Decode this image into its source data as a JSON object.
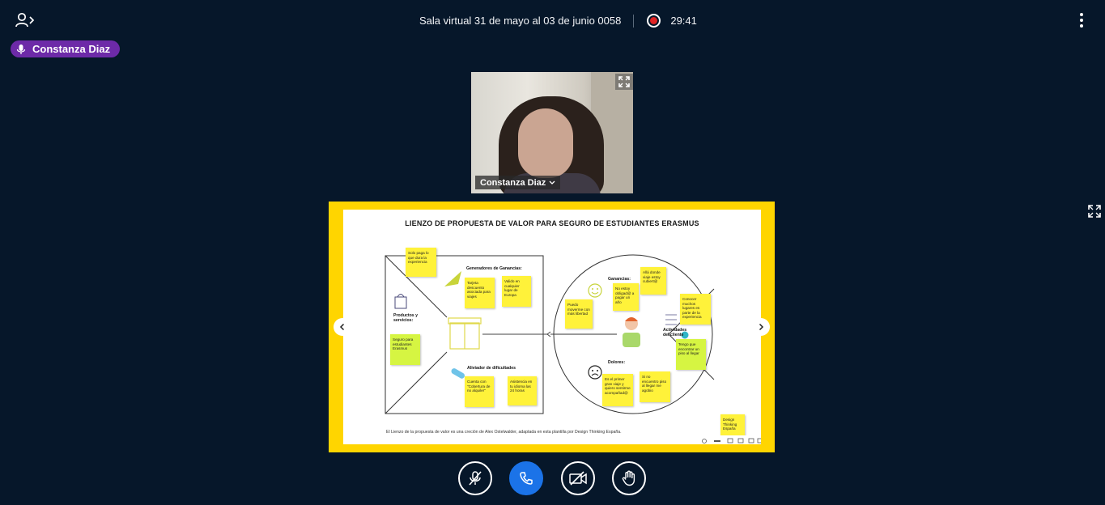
{
  "session": {
    "title": "Sala virtual 31 de mayo al 03 de junio 0058",
    "recording_time": "29:41",
    "recording_color": "#e02424"
  },
  "talker": {
    "name": "Constanza Diaz",
    "color": "#6d2aa8"
  },
  "webcam": {
    "name": "Constanza Diaz"
  },
  "slide": {
    "title": "LIENZO DE PROPUESTA DE VALOR PARA SEGURO DE ESTUDIANTES ERASMUS",
    "footer": "El Lienzo de la propuesta de valor es una creción de Alex Ostelwalder, adaptada en esta plantilla por Design Thinking España.",
    "labels": {
      "gains_creators": "Generadores de Ganancias:",
      "products": "Productos y servicios:",
      "pain_relievers": "Aliviador de dificultades",
      "gains": "Ganancias:",
      "pains": "Dolores:",
      "jobs": "Actividades del cliente"
    },
    "notes": {
      "n1": "Solo paga lo que dura la experiencia",
      "n2": "Tarjeta descuento asociada para viajes",
      "n3": "Valido en cualquier lugar de Europa",
      "n4": "Seguro para estudiantes Erasmus",
      "n5": "Cuenta con \"Cobertura de no alquiler\"",
      "n6": "Asistencia en tu idioma las 24 horas",
      "n7": "Allá donde viaje estoy cubiert@",
      "n8": "No estoy obligad@ a pagar un año",
      "n9": "Puedo moverme con más libertad",
      "n10": "Conocer muchos lugares es parte de la experiencia",
      "n11": "Tengo que encontrar un piso al llegar",
      "n12": "Es el primer gran viaje y quiero sentirme acompañad@",
      "n13": "Si no encuentro piso al llegar me agobio",
      "n14": "Design Thinking España"
    }
  },
  "icons": {
    "participants": "users-icon",
    "more": "kebab-icon",
    "mic": "microphone-icon",
    "expand": "expand-icon",
    "prev": "chevron-left-icon",
    "next": "chevron-right-icon",
    "mute": "microphone-muted-icon",
    "leave_audio": "phone-icon",
    "camera": "camera-off-icon",
    "hand": "raise-hand-icon"
  },
  "colors": {
    "background": "#06172a",
    "presentation_frame": "#ffd500",
    "primary_button": "#1b73e8"
  }
}
